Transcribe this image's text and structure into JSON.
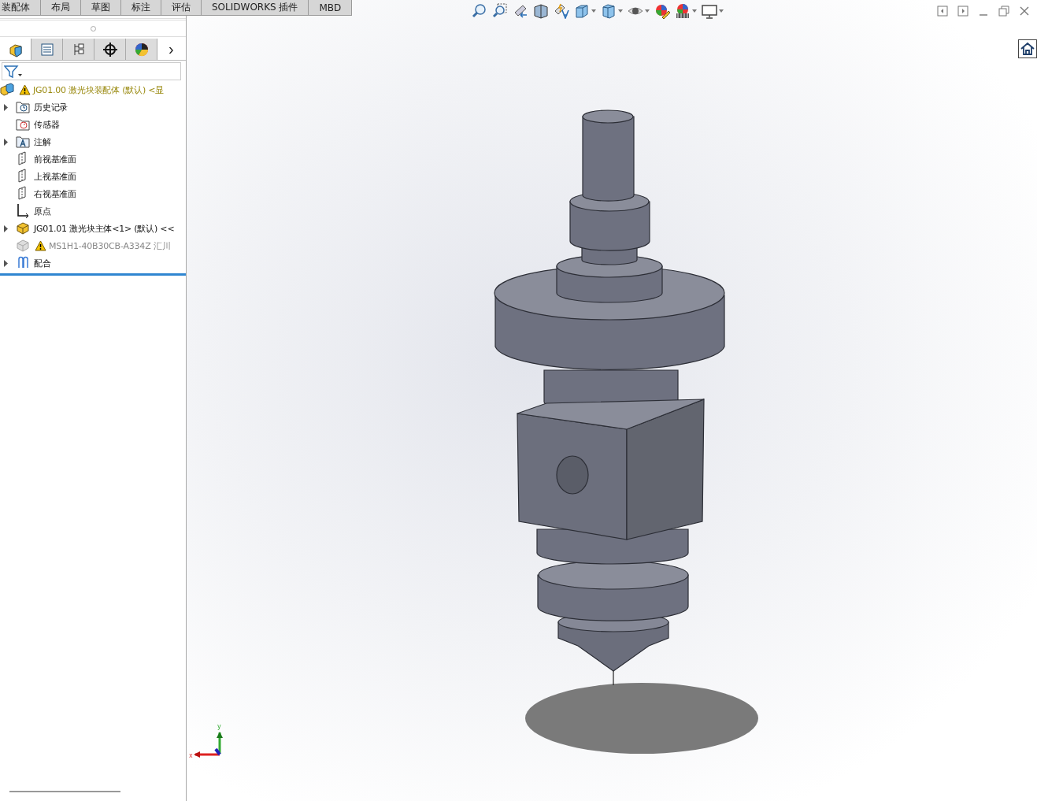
{
  "command_tabs": [
    {
      "label": "装配体"
    },
    {
      "label": "布局"
    },
    {
      "label": "草图"
    },
    {
      "label": "标注"
    },
    {
      "label": "评估"
    },
    {
      "label": "SOLIDWORKS 插件"
    },
    {
      "label": "MBD"
    }
  ],
  "panel_tabs": [
    {
      "kind": "feature-tree",
      "selected": true
    },
    {
      "kind": "property",
      "selected": false
    },
    {
      "kind": "config",
      "selected": false
    },
    {
      "kind": "dimxpert",
      "selected": false
    },
    {
      "kind": "display",
      "selected": false
    }
  ],
  "panel_more": "›",
  "tree": [
    {
      "kind": "assembly",
      "label": "JG01.00 激光块装配体 (默认) <显",
      "warning": true
    },
    {
      "kind": "history",
      "label": "历史记录",
      "expanded": false
    },
    {
      "kind": "sensor",
      "label": "传感器"
    },
    {
      "kind": "annotation",
      "label": "注解",
      "expanded": false
    },
    {
      "kind": "plane",
      "label": "前视基准面"
    },
    {
      "kind": "plane",
      "label": "上视基准面"
    },
    {
      "kind": "plane",
      "label": "右视基准面"
    },
    {
      "kind": "origin",
      "label": "原点"
    },
    {
      "kind": "part",
      "label": "JG01.01 激光块主体<1> (默认) <<",
      "expanded": false
    },
    {
      "kind": "part",
      "label": "MS1H1-40B30CB-A334Z 汇川",
      "warning": true,
      "suppressed": true
    },
    {
      "kind": "mates",
      "label": "配合",
      "expanded": false
    }
  ],
  "triad": {
    "x": "x",
    "y": "y"
  }
}
